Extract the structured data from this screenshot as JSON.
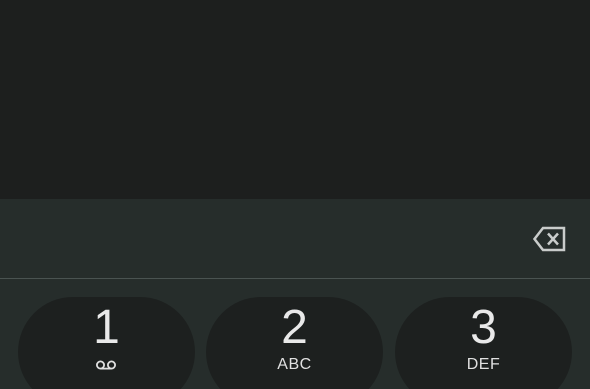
{
  "dialer": {
    "number_value": "",
    "icons": {
      "backspace": "backspace-icon",
      "voicemail": "voicemail-icon"
    },
    "keys": [
      {
        "digit": "1",
        "letters": "",
        "icon": "voicemail-icon"
      },
      {
        "digit": "2",
        "letters": "ABC"
      },
      {
        "digit": "3",
        "letters": "DEF"
      }
    ]
  },
  "colors": {
    "background": "#1d1f1e",
    "panel": "#262d2b",
    "key": "#1d201f",
    "text": "#e9e9e9",
    "divider": "#4a5351"
  }
}
